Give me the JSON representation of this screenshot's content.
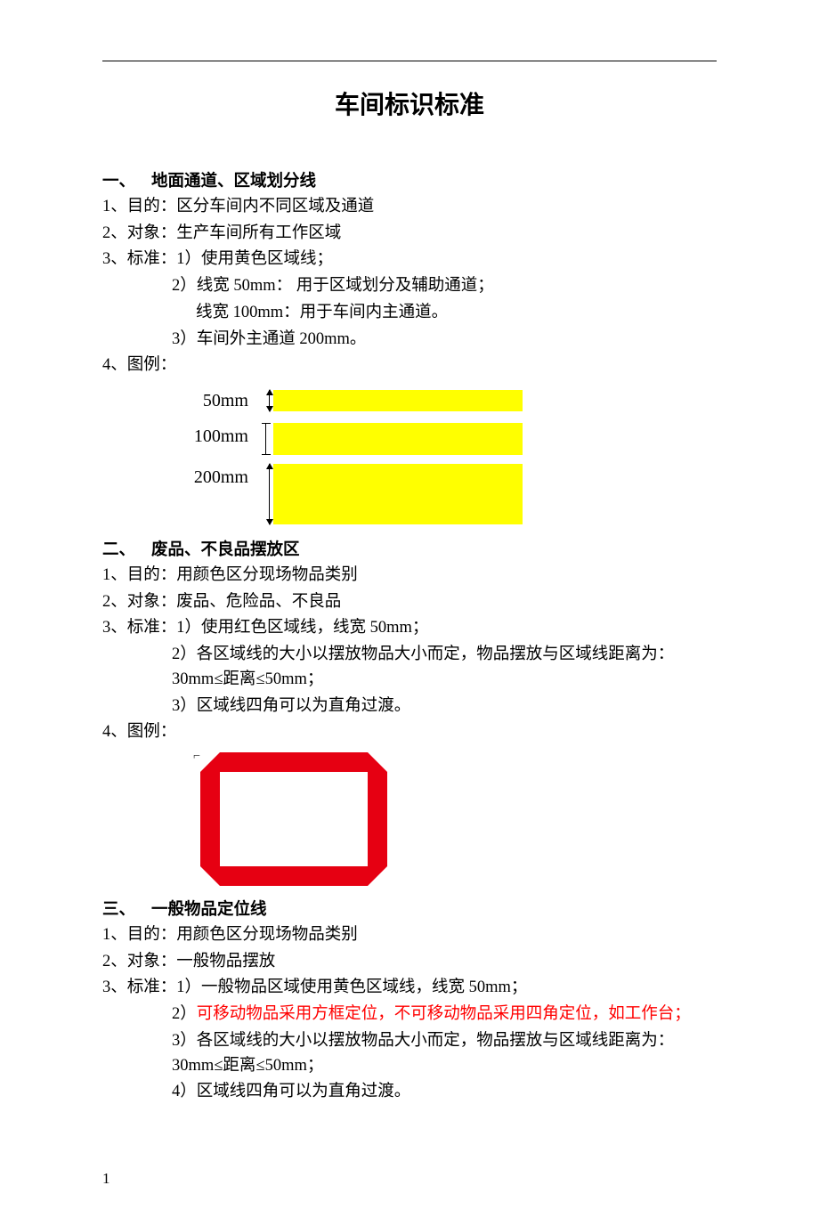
{
  "title": "车间标识标准",
  "page_number": "1",
  "section1": {
    "num": "一、",
    "heading": "地面通道、区域划分线",
    "l1": "1、目的：区分车间内不同区域及通道",
    "l2": "2、对象：生产车间所有工作区域",
    "l3": "3、标准：1）使用黄色区域线；",
    "l4": "2）线宽 50mm：  用于区域划分及辅助通道；",
    "l5": "线宽 100mm：用于车间内主通道。",
    "l6": "3）车间外主通道 200mm。",
    "l7": "4、图例：",
    "bar50_label": "50mm",
    "bar100_label": "100mm",
    "bar200_label": "200mm"
  },
  "section2": {
    "num": "二、",
    "heading": "废品、不良品摆放区",
    "l1": "1、目的：用颜色区分现场物品类别",
    "l2": "2、对象：废品、危险品、不良品",
    "l3": "3、标准：1）使用红色区域线，线宽 50mm；",
    "l4": "2）各区域线的大小以摆放物品大小而定，物品摆放与区域线距离为：30mm≤距离≤50mm；",
    "l5": "3）区域线四角可以为直角过渡。",
    "l6": "4、图例："
  },
  "section3": {
    "num": "三、",
    "heading": "一般物品定位线",
    "l1": "1、目的：用颜色区分现场物品类别",
    "l2": "2、对象：一般物品摆放",
    "l3": "3、标准：1）一般物品区域使用黄色区域线，线宽 50mm；",
    "l4a": "2）",
    "l4b": "可移动物品采用方框定位，不可移动物品采用四角定位，如工作台；",
    "l5": "3）各区域线的大小以摆放物品大小而定，物品摆放与区域线距离为：30mm≤距离≤50mm；",
    "l6": "4）区域线四角可以为直角过渡。"
  },
  "colors": {
    "yellow": "#ffff00",
    "red": "#e60012",
    "highlight": "#ff0000"
  }
}
